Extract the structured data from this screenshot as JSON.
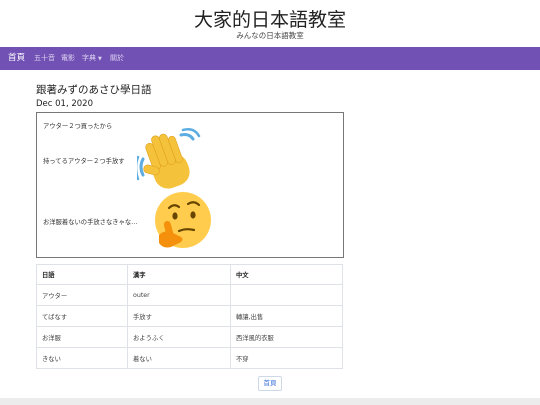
{
  "site": {
    "title": "大家的日本語教室",
    "subtitle": "みんなの日本語教室"
  },
  "nav": {
    "brand": "首頁",
    "items": [
      {
        "label": "五十音"
      },
      {
        "label": "電影"
      },
      {
        "label": "字典",
        "has_dropdown": true
      },
      {
        "label": "關於"
      }
    ]
  },
  "post": {
    "title": "跟著みずのあさひ學日語",
    "date": "Dec 01, 2020",
    "lines": [
      "アウター２つ買ったから",
      "持ってるアウター２つ手放す",
      "お洋服着ないの手放さなきゃな…"
    ],
    "emojis": [
      "waving-hand",
      "thinking-face"
    ]
  },
  "table": {
    "headers": [
      "日語",
      "漢字",
      "中文"
    ],
    "rows": [
      [
        "アウター",
        "outer",
        ""
      ],
      [
        "てばなす",
        "手放す",
        "轉讓,出售"
      ],
      [
        "お洋服",
        "おようふく",
        "西洋風的衣服"
      ],
      [
        "きない",
        "着ない",
        "不穿"
      ]
    ]
  },
  "pagination": {
    "home_label": "首頁"
  },
  "colors": {
    "navbar": "#7251b5",
    "link": "#3a6fd8"
  }
}
